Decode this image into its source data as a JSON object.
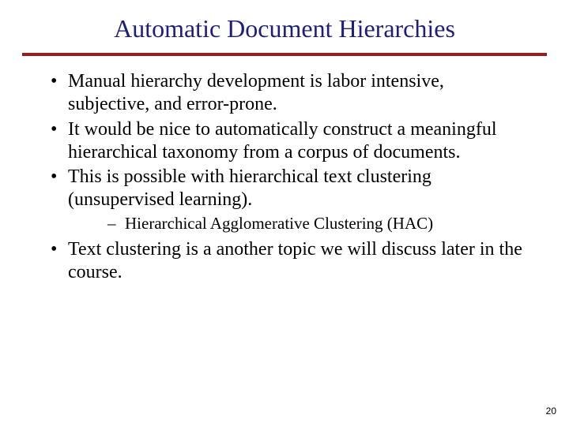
{
  "title": "Automatic Document Hierarchies",
  "colors": {
    "title": "#1e1e7a",
    "rule": "#9b1c1c"
  },
  "bullets": [
    {
      "text": "Manual hierarchy development is labor intensive, subjective, and error-prone."
    },
    {
      "text": "It would be nice to automatically construct a meaningful hierarchical taxonomy from a corpus of documents."
    },
    {
      "text": "This is possible with hierarchical text clustering (unsupervised learning).",
      "sub": [
        {
          "text": "Hierarchical Agglomerative Clustering (HAC)"
        }
      ]
    },
    {
      "text": "Text clustering is a another topic we will discuss later in the course."
    }
  ],
  "page_number": "20"
}
